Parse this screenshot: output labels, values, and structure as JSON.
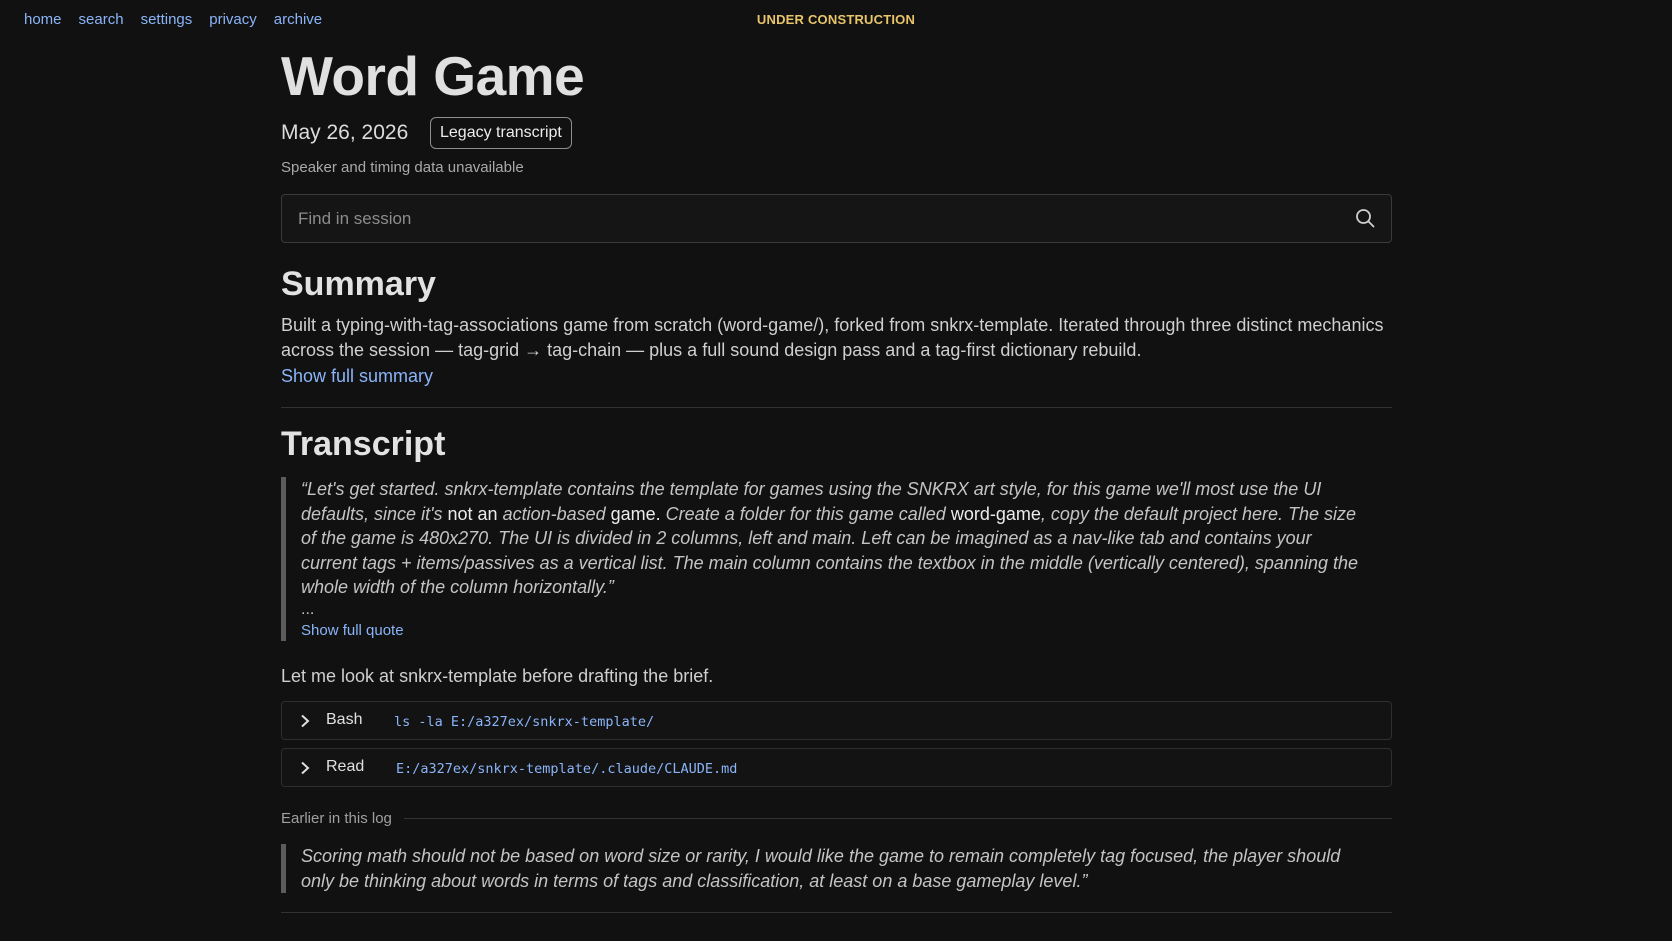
{
  "nav": {
    "links": [
      "home",
      "search",
      "settings",
      "privacy",
      "archive"
    ],
    "banner": "UNDER CONSTRUCTION"
  },
  "page": {
    "title": "Word Game",
    "date": "May 26, 2026",
    "badge": "Legacy transcript",
    "meta": "Speaker and timing data unavailable"
  },
  "search": {
    "placeholder": "Find in session",
    "icon": "search-icon"
  },
  "summary": {
    "heading": "Summary",
    "text": "Built a typing-with-tag-associations game from scratch (word-game/), forked from snkrx-template. Iterated through three distinct mechanics across the session — tag-grid → tag-chain — plus a full sound design pass and a tag-first dictionary rebuild.",
    "show_more": "Show full summary"
  },
  "transcript": {
    "heading": "Transcript",
    "quote": {
      "p1": "“Let's get started. snkrx-template contains the template for games using the SNKRX art style, for this game we'll most use the UI defaults, since it's ",
      "h1": "not an",
      "p2": " action-based ",
      "h2": "game.",
      "p3": " Create a folder for this game called ",
      "h3": "word-game",
      "p4": ", copy the default project here. The size of the game is 480x270. The UI is divided in 2 columns, left and main. Left can be imagined as a nav-like tab and contains your current tags + items/passives as a vertical list. The main column contains the textbox in the middle (vertically centered), spanning the whole width of the column horizontally.”",
      "ellipsis": "...",
      "show_more": "Show full quote"
    },
    "reply": "Let me look at snkrx-template before drafting the brief.",
    "tools": [
      {
        "name": "Bash",
        "command": "ls -la E:/a327ex/snkrx-template/"
      },
      {
        "name": "Read",
        "command": "E:/a327ex/snkrx-template/.claude/CLAUDE.md"
      }
    ],
    "earlier_label": "Earlier in this log",
    "earlier_quote": "Scoring math should not be based on word size or rarity, I would like the game to remain completely tag focused, the player should only be thinking about words in terms of tags and classification, at least on a base gameplay level.”"
  },
  "colors": {
    "background": "#111111",
    "link": "#8ab4f8",
    "banner": "#e8c46a",
    "text": "#d6d6d6"
  }
}
